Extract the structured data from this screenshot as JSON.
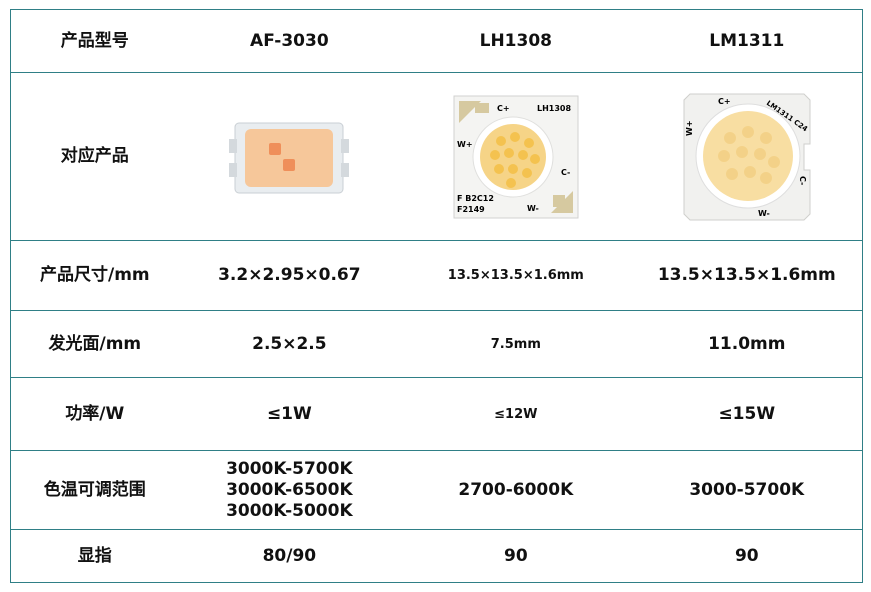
{
  "header": {
    "label": "产品型号",
    "models": [
      "AF-3030",
      "LH1308",
      "LM1311"
    ]
  },
  "rows": {
    "image": {
      "label": "对应产品"
    },
    "size": {
      "label": "产品尺寸/mm",
      "values": [
        "3.2×2.95×0.67",
        "13.5×13.5×1.6mm",
        "13.5×13.5×1.6mm"
      ]
    },
    "emit": {
      "label": "发光面/mm",
      "values": [
        "2.5×2.5",
        "7.5mm",
        "11.0mm"
      ]
    },
    "power": {
      "label": "功率/W",
      "values": [
        "≤1W",
        "≤12W",
        "≤15W"
      ]
    },
    "cct": {
      "label": "色温可调范围",
      "values": [
        [
          "3000K-5700K",
          "3000K-6500K",
          "3000K-5000K"
        ],
        "2700-6000K",
        "3000-5700K"
      ]
    },
    "cri": {
      "label": "显指",
      "values": [
        "80/90",
        "90",
        "90"
      ]
    }
  },
  "chip_markings": {
    "lh1308": {
      "model": "LH1308",
      "plus": "C+",
      "w_plus": "W+",
      "c_minus": "C-",
      "w_minus": "W-",
      "code1": "F B2C12",
      "code2": "F2149"
    },
    "lm1311": {
      "model": "LM1311 C24",
      "plus": "C+",
      "w_plus": "W+",
      "c_minus": "C-",
      "w_minus": "W-"
    }
  },
  "colors": {
    "border": "#2f7f86",
    "led_warm": "#f4c77a",
    "led_amber": "#f39a4d"
  }
}
